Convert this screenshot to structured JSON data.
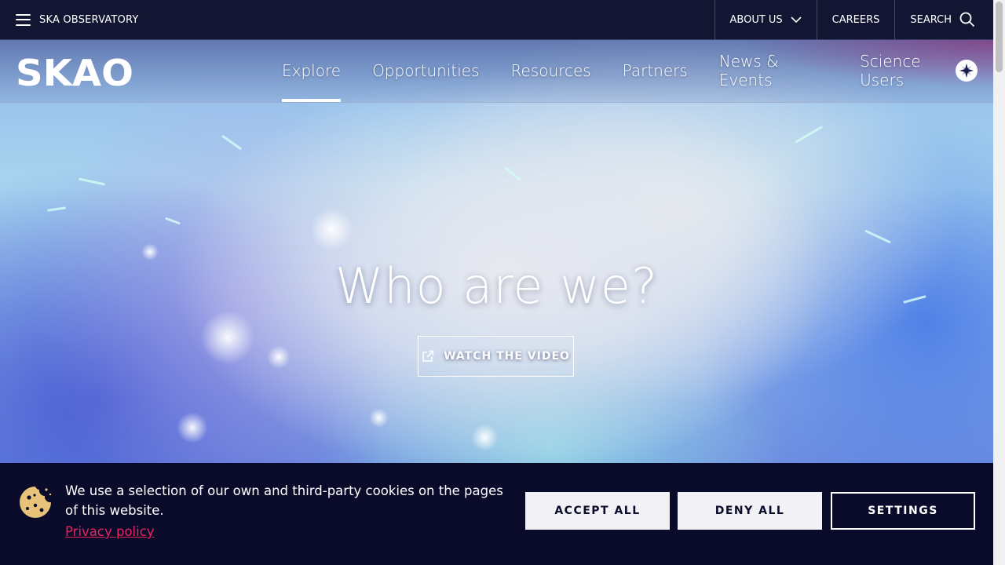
{
  "topbar": {
    "org_name": "SKA OBSERVATORY",
    "about_label": "ABOUT US",
    "careers_label": "CAREERS",
    "search_label": "SEARCH"
  },
  "nav": {
    "logo_text": "SKAO",
    "items": [
      {
        "label": "Explore",
        "active": true
      },
      {
        "label": "Opportunities"
      },
      {
        "label": "Resources"
      },
      {
        "label": "Partners"
      },
      {
        "label": "News & Events"
      },
      {
        "label": "Science Users"
      }
    ]
  },
  "hero": {
    "title": "Who are we?",
    "button_label": "WATCH THE VIDEO"
  },
  "cookie": {
    "message": "We use a selection of our own and third-party cookies on the pages of this website.",
    "privacy_link": "Privacy policy",
    "accept_label": "ACCEPT ALL",
    "deny_label": "DENY ALL",
    "settings_label": "SETTINGS"
  },
  "colors": {
    "topbar_bg": "#131633",
    "cookie_bg": "#0a0b2a",
    "privacy_link": "#e8245f",
    "cookie_icon": "#e9c27a"
  },
  "icons": {
    "menu": "hamburger-icon",
    "about_dropdown": "chevron-down-icon",
    "search": "search-icon",
    "science_users": "compass-icon",
    "watch_video": "external-link-icon",
    "cookie": "cookie-icon"
  }
}
